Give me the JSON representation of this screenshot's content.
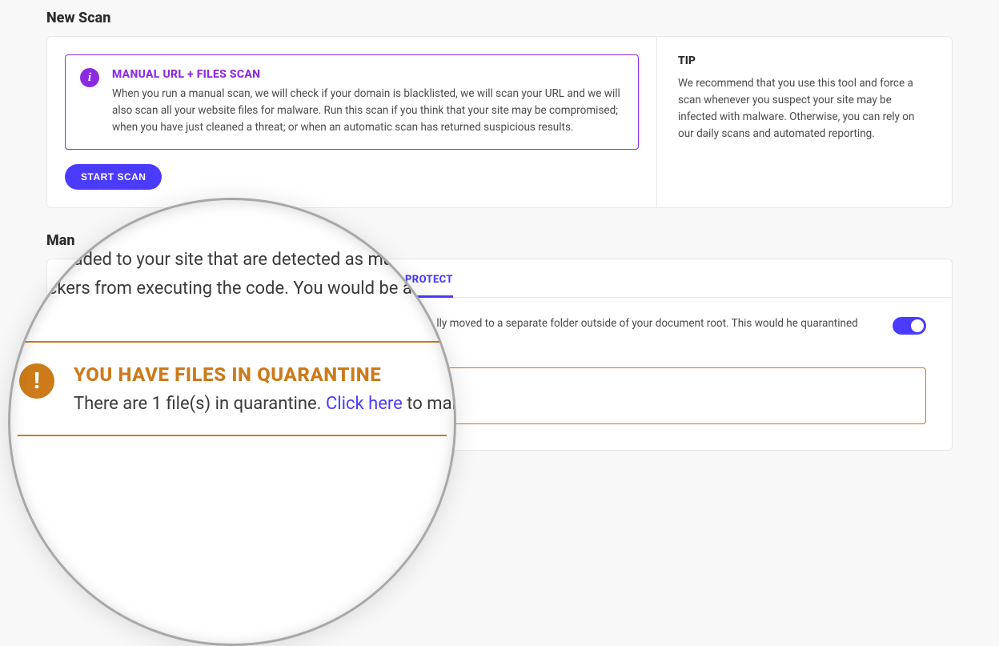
{
  "colors": {
    "accent_purple": "#8a2be2",
    "accent_indigo": "#4b3bff",
    "accent_orange": "#cc7a1a"
  },
  "newScan": {
    "section_title": "New Scan",
    "info_title": "MANUAL URL + FILES SCAN",
    "info_body": "When you run a manual scan, we will check if your domain is blacklisted, we will scan your URL and we will also scan all your website files for malware. Run this scan if you think that your site may be compromised; when you have just cleaned a threat; or when an automatic scan has returned suspicious results.",
    "start_scan_label": "START SCAN",
    "tip_title": "TIP",
    "tip_body": "We recommend that you use this tool and force a scan whenever you suspect your site may be infected with malware. Otherwise, you can rely on our daily scans and automated reporting."
  },
  "manage": {
    "section_title": "Man",
    "tabs": [
      {
        "label": "PROTECT",
        "id": "protect",
        "active": true
      }
    ],
    "desc_visible": "lly moved to a separate folder outside of your document root. This would he quarantined files separately either restoring or deleting them.",
    "toggle_on": true,
    "alert_title": "YOU HAVE FILES IN QUARANTINE",
    "alert_body_pre": "There are 1 file(s) in quarantine. ",
    "alert_link": "Click here",
    "alert_body_post": " to manage."
  },
  "magnifier": {
    "desc_line1": "uploaded to your site that are detected as malicio",
    "desc_line2": "t hackers from executing the code. You would be able t",
    "alert_title": "YOU HAVE FILES IN QUARANTINE",
    "alert_body_pre": "There are 1 file(s) in quarantine. ",
    "alert_link": "Click here",
    "alert_body_post": " to manage."
  }
}
